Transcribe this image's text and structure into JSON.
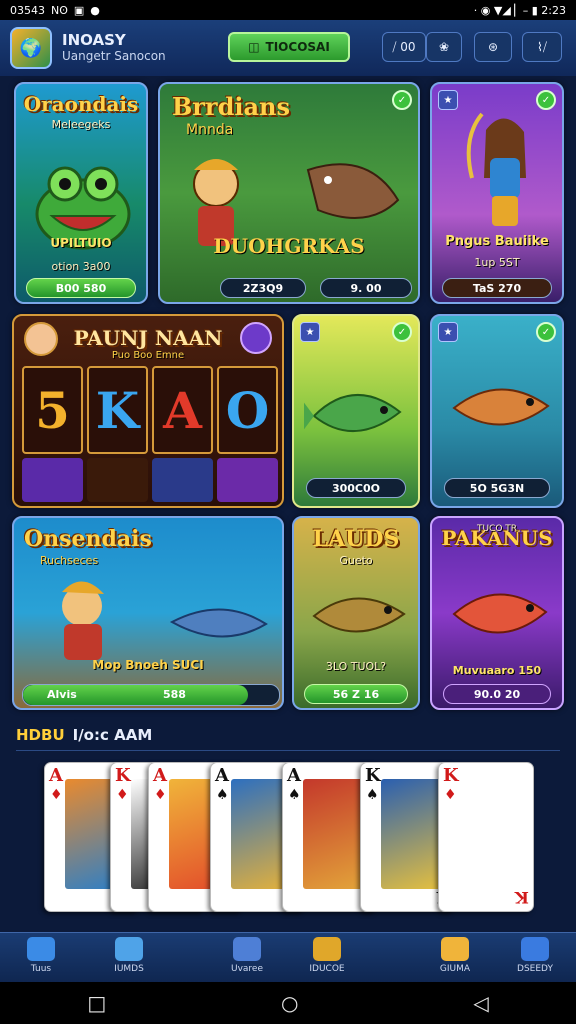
{
  "status_bar": {
    "time_left": "03543",
    "left_icons": [
      "Nʘ",
      "▣",
      "●"
    ],
    "right_text": "· ◉ ▼◢ ▏– ▮ 2:23",
    "clock": "2:23"
  },
  "header": {
    "app_name": "INOASY",
    "app_subtitle": "Uangetr Sanocon",
    "primary_button": "TIOCOSAI",
    "controls": [
      "⧸ 00",
      "❀",
      "⊛",
      "⌇⧸"
    ]
  },
  "tiles": [
    {
      "title": "Oraondais",
      "subtitle": "Meleegeks",
      "caption": "UPILTUIO",
      "footer": "otion 3a00",
      "button": "B00 580",
      "colors": [
        "#1b8fbf",
        "#7fd45a"
      ]
    },
    {
      "title": "Brrdians",
      "subtitle": "Mnnda",
      "caption": "DUOHGRKAS",
      "footer": "",
      "button": "2Z3Q9",
      "button2": "9. 00",
      "colors": [
        "#3f8d3a",
        "#c49a45"
      ]
    },
    {
      "title": "",
      "subtitle": "",
      "caption": "Pngus Bauiike",
      "footer": "1up 5ST",
      "button": "TaS 270",
      "colors": [
        "#6c3aa8",
        "#e47ab3"
      ]
    },
    {
      "title": "PAUNJ NAAN",
      "subtitle": "Puo Boo Emne",
      "caption": "",
      "footer": "",
      "button": "",
      "reels": [
        "5",
        "K",
        "A",
        "O"
      ],
      "colors": [
        "#3b1a0f",
        "#d08b2c"
      ]
    },
    {
      "title": "",
      "subtitle": "",
      "caption": "",
      "footer": "",
      "button": "300C0O",
      "colors": [
        "#b7cf3a",
        "#3c8a3a"
      ]
    },
    {
      "title": "",
      "subtitle": "",
      "caption": "",
      "footer": "",
      "button": "5O 5G3N",
      "colors": [
        "#2a9bbd",
        "#6fd0c9"
      ]
    },
    {
      "title": "Onsendais",
      "subtitle": "Ruchseces",
      "caption": "Mop Bnoeh SUCI",
      "footer": "",
      "button": "Alvis",
      "button2": "588",
      "colors": [
        "#1c85b8",
        "#c9a565"
      ]
    },
    {
      "title": "LAUDS",
      "subtitle": "Gueto",
      "caption": "",
      "footer": "",
      "button": "3LO TUOL?",
      "button2": "56 Z 16",
      "colors": [
        "#c49a3c",
        "#6e8d35"
      ]
    },
    {
      "title": "PAKANUS",
      "subtitle": "TUCO TR",
      "caption": "Muvuaaro 150",
      "footer": "",
      "button": "90.0 20",
      "colors": [
        "#4b2a96",
        "#d14a8a"
      ]
    }
  ],
  "section": {
    "title_a": "HDBU",
    "title_b": "I/o:c AAM"
  },
  "cards": [
    {
      "rank": "A",
      "suit": "♦",
      "suit_color": "red",
      "art": [
        "#e98a2e",
        "#2a7fc9"
      ]
    },
    {
      "rank": "K",
      "suit": "♦",
      "suit_color": "red",
      "art": [
        "#ffffff",
        "#222222"
      ]
    },
    {
      "rank": "A",
      "suit": "♦",
      "suit_color": "red",
      "art": [
        "#f0b43a",
        "#e24b2a"
      ]
    },
    {
      "rank": "A",
      "suit": "♠",
      "suit_color": "black",
      "art": [
        "#2d6fbf",
        "#e6b23a"
      ]
    },
    {
      "rank": "A",
      "suit": "♠",
      "suit_color": "black",
      "art": [
        "#c4382b",
        "#e3a53a"
      ]
    },
    {
      "rank": "K",
      "suit": "♠",
      "suit_color": "black",
      "art": [
        "#2a5fb0",
        "#e7c13e"
      ]
    },
    {
      "rank": "K",
      "suit": "♦",
      "suit_color": "red",
      "art": [
        "#ffffff",
        "#ffffff"
      ]
    }
  ],
  "bottom_nav": [
    {
      "label": "Tuus",
      "icon_color": "#3b8be6"
    },
    {
      "label": "IUMDS",
      "icon_color": "#4fa3e8"
    },
    {
      "label": "Uvaree",
      "icon_color": "#4e7fd6"
    },
    {
      "label": "IDUCOE",
      "icon_color": "#e0a72a"
    },
    {
      "label": "GIUMA",
      "icon_color": "#f0b43a"
    },
    {
      "label": "DSEEDY",
      "icon_color": "#3a7be0"
    }
  ],
  "system_nav": {
    "recent": "□",
    "home": "○",
    "back": "◁"
  }
}
